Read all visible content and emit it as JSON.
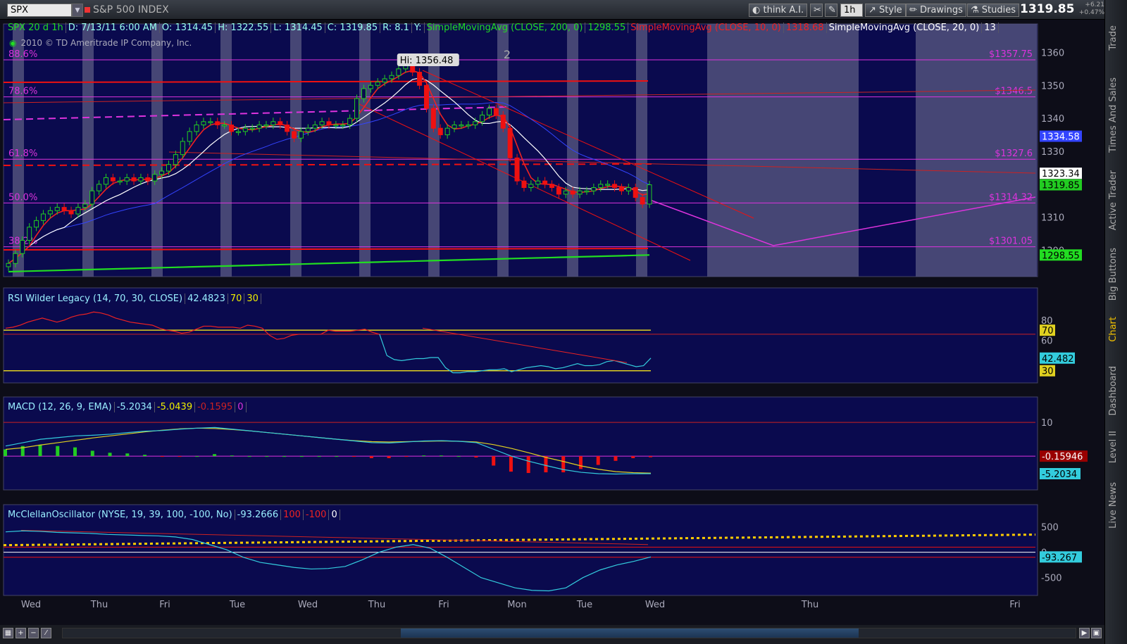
{
  "toolbar": {
    "symbol": "SPX",
    "symbol_name": "S&P 500 INDEX",
    "think_ai": "think A.I.",
    "interval": "1h",
    "style": "Style",
    "drawings": "Drawings",
    "studies": "Studies",
    "last_price": "1319.85",
    "change": "+6.21",
    "change_pct": "+0.47%"
  },
  "side_tabs": [
    "Trade",
    "Times And Sales",
    "Active Trader",
    "Big Buttons",
    "Chart",
    "Dashboard",
    "Level II",
    "Live News"
  ],
  "price_panel": {
    "header": [
      "SPX 20 d 1h",
      "D: 7/13/11 6:00 AM",
      "O: 1314.45",
      "H: 1322.55",
      "L: 1314.45",
      "C: 1319.85",
      "R: 8.1",
      "Y:"
    ],
    "studies": [
      {
        "text": "SimpleMovingAvg (CLOSE, 200, 0)",
        "value": "1298.55",
        "color": "#22dd22"
      },
      {
        "text": "SimpleMovingAvg (CLOSE, 10, 0)",
        "value": "1318.68",
        "color": "#ee2222"
      },
      {
        "text": "SimpleMovingAvg (CLOSE, 20, 0)",
        "value": "13",
        "color": "#ffffff"
      }
    ],
    "copyright": "2010 © TD Ameritrade IP Company, Inc.",
    "hi_label": "Hi: 1356.48",
    "wave_label": "2"
  },
  "rsi_panel": {
    "header": [
      "RSI Wilder Legacy (14, 70, 30, CLOSE)",
      "42.4823",
      "70",
      "30"
    ]
  },
  "macd_panel": {
    "header": [
      "MACD (12, 26, 9, EMA)",
      "-5.2034",
      "-5.0439",
      "-0.1595",
      "0"
    ]
  },
  "mcc_panel": {
    "header": [
      "McClellanOscillator (NYSE, 19, 39, 100, -100, No)",
      "-93.2666",
      "100",
      "-100",
      "0"
    ]
  },
  "colors": {
    "background": "#0a0a4e",
    "up": "#22cc22",
    "down": "#ee1111",
    "fib": "#dd33dd",
    "sma200": "#22dd22",
    "sma10": "#ee2222",
    "sma20": "#ffffff",
    "sma50": "#3344ff",
    "rsi": "#33ccdd",
    "signal": "#e0d020"
  },
  "chart_data": [
    {
      "type": "candlestick",
      "title": "SPX 20 d 1h",
      "ylim": [
        1292,
        1365
      ],
      "y_ticks": [
        1300,
        1310,
        1320,
        1330,
        1340,
        1350,
        1360
      ],
      "x_tick_labels": [
        "Wed",
        "Thu",
        "Fri",
        "Tue",
        "Wed",
        "Thu",
        "Fri",
        "Mon",
        "Tue",
        "Wed",
        "Thu",
        "Fri"
      ],
      "fib_levels": [
        {
          "pct": "88.6%",
          "price": "$1357.75",
          "value": 1357.75
        },
        {
          "pct": "78.6%",
          "price": "$1346.5",
          "value": 1346.5
        },
        {
          "pct": "61.8%",
          "price": "$1327.6",
          "value": 1327.6
        },
        {
          "pct": "50.0%",
          "price": "$1314.32",
          "value": 1314.32
        },
        {
          "pct": "38.2%",
          "price": "$1301.05",
          "value": 1301.05
        }
      ],
      "right_labels": [
        {
          "value": "1334.58",
          "color": "#3344ff",
          "text_color": "#ffffff",
          "y": 1334.58
        },
        {
          "value": "1323.34",
          "color": "#ffffff",
          "text_color": "#000000",
          "y": 1323.34
        },
        {
          "value": "1319.85",
          "color": "#22cc22",
          "text_color": "#000000",
          "y": 1319.85
        },
        {
          "value": "1298.55",
          "color": "#22dd22",
          "text_color": "#000000",
          "y": 1298.55
        }
      ],
      "close": [
        1296,
        1299,
        1303,
        1307,
        1309,
        1311,
        1312,
        1313,
        1312,
        1311,
        1313,
        1314,
        1318,
        1320,
        1322,
        1321,
        1321,
        1322,
        1321,
        1322,
        1321,
        1323,
        1324,
        1326,
        1329,
        1333,
        1336,
        1338,
        1339,
        1339,
        1338,
        1338,
        1336,
        1336,
        1337,
        1337,
        1338,
        1338,
        1339,
        1338,
        1336,
        1334,
        1336,
        1337,
        1338,
        1339,
        1338,
        1338,
        1338,
        1340,
        1346,
        1349,
        1350,
        1351,
        1352,
        1353,
        1355,
        1356,
        1354,
        1350,
        1343,
        1337,
        1335,
        1337,
        1338,
        1338,
        1338,
        1339,
        1341,
        1343,
        1341,
        1337,
        1328,
        1321,
        1319,
        1320,
        1321,
        1320,
        1319,
        1317,
        1318,
        1317,
        1318,
        1318,
        1319,
        1320,
        1320,
        1319,
        1318,
        1319,
        1316,
        1314,
        1319.85
      ],
      "studies": {
        "sma200_end": 1298.55,
        "sma10_end": 1318.68,
        "sma20_end": 1323.34,
        "sma50_end": 1334.58
      }
    },
    {
      "type": "line",
      "title": "RSI Wilder Legacy (14, 70, 30, CLOSE)",
      "ylim": [
        18,
        100
      ],
      "y_ticks": [
        60,
        80
      ],
      "levels": [
        70,
        30
      ],
      "last_value": "42.482",
      "values": [
        72,
        73,
        75,
        78,
        80,
        82,
        80,
        78,
        80,
        83,
        85,
        86,
        88,
        87,
        85,
        82,
        80,
        78,
        77,
        76,
        75,
        72,
        70,
        69,
        67,
        68,
        71,
        74,
        74,
        73,
        73,
        73,
        72,
        75,
        74,
        72,
        65,
        61,
        62,
        65,
        66,
        66,
        66,
        66,
        70,
        69,
        69,
        69,
        70,
        71,
        68,
        66,
        45,
        41,
        40,
        41,
        42,
        42,
        43,
        43,
        33,
        28,
        28,
        29,
        29,
        30,
        31,
        31,
        32,
        29,
        31,
        33,
        34,
        35,
        34,
        32,
        33,
        35,
        37,
        35,
        35,
        36,
        39,
        40,
        38,
        36,
        34,
        35,
        42.48
      ]
    },
    {
      "type": "line",
      "title": "MACD (12, 26, 9, EMA)",
      "ylim": [
        -10,
        14
      ],
      "y_ticks": [
        10
      ],
      "last_value": "-5.2034",
      "hist_label": "-0.15946",
      "series": [
        {
          "name": "MACD",
          "values": [
            3,
            4,
            5,
            5.5,
            6,
            6.2,
            6.5,
            7,
            7.4,
            7.6,
            8,
            8.3,
            8.5,
            8,
            7.5,
            7,
            6.5,
            6,
            5.5,
            5,
            4.5,
            4,
            3.9,
            4.2,
            4.5,
            4.6,
            4.4,
            4,
            2,
            0,
            -1.5,
            -2.8,
            -4,
            -4.8,
            -5.2,
            -5.3,
            -5.2,
            -5.2034
          ]
        },
        {
          "name": "Signal",
          "values": [
            2,
            2.5,
            3.3,
            4,
            4.7,
            5.4,
            6,
            6.6,
            7.2,
            7.7,
            8.1,
            8.3,
            8.2,
            7.9,
            7.5,
            7,
            6.5,
            6,
            5.5,
            5,
            4.6,
            4.3,
            4.2,
            4.3,
            4.4,
            4.5,
            4.4,
            4.2,
            3.4,
            2.3,
            1,
            -0.4,
            -1.6,
            -2.9,
            -3.9,
            -4.6,
            -4.9,
            -5.0439
          ]
        }
      ]
    },
    {
      "type": "line",
      "title": "McClellanOscillator (NYSE, 19, 39, 100, -100, No)",
      "ylim": [
        -850,
        700
      ],
      "y_ticks": [
        500,
        0,
        -500
      ],
      "levels": [
        100,
        -100
      ],
      "last_value": "-93.267",
      "values": [
        400,
        420,
        410,
        390,
        380,
        370,
        350,
        340,
        330,
        320,
        300,
        250,
        150,
        50,
        -100,
        -200,
        -250,
        -300,
        -330,
        -320,
        -280,
        -150,
        0,
        100,
        150,
        80,
        -100,
        -300,
        -500,
        -600,
        -700,
        -750,
        -760,
        -700,
        -500,
        -350,
        -250,
        -180,
        -93.27
      ]
    }
  ]
}
